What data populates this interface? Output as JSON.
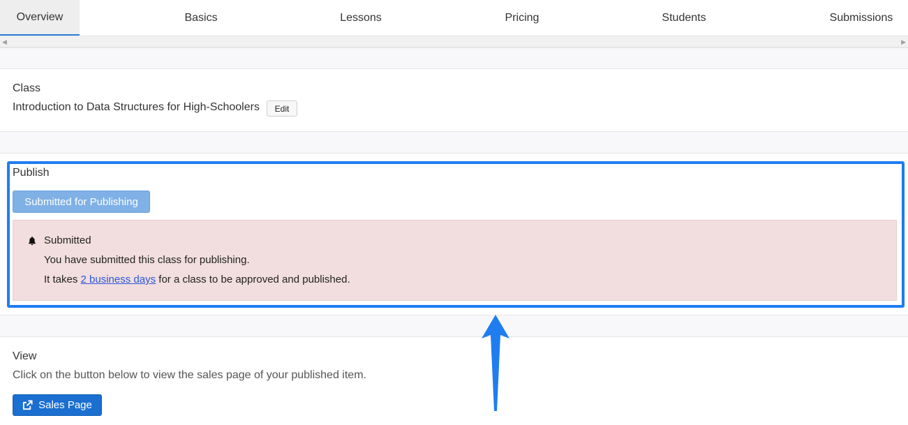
{
  "tabs": [
    {
      "label": "Overview",
      "active": true
    },
    {
      "label": "Basics",
      "active": false
    },
    {
      "label": "Lessons",
      "active": false
    },
    {
      "label": "Pricing",
      "active": false
    },
    {
      "label": "Students",
      "active": false
    },
    {
      "label": "Submissions",
      "active": false
    }
  ],
  "class_section": {
    "label": "Class",
    "name": "Introduction to Data Structures for High-Schoolers",
    "edit_label": "Edit"
  },
  "publish_section": {
    "label": "Publish",
    "button_label": "Submitted for Publishing",
    "alert": {
      "title": "Submitted",
      "message": "You have submitted this class for publishing.",
      "prefix": "It takes ",
      "link_text": "2 business days",
      "suffix": " for a class to be approved and published."
    }
  },
  "view_section": {
    "label": "View",
    "description": "Click on the button below to view the sales page of your published item.",
    "button_label": "Sales Page"
  },
  "colors": {
    "highlight": "#1f7df0",
    "alert_bg": "#f2dede",
    "primary_button": "#1a6fd0",
    "disabled_button": "#7fb0e6"
  }
}
